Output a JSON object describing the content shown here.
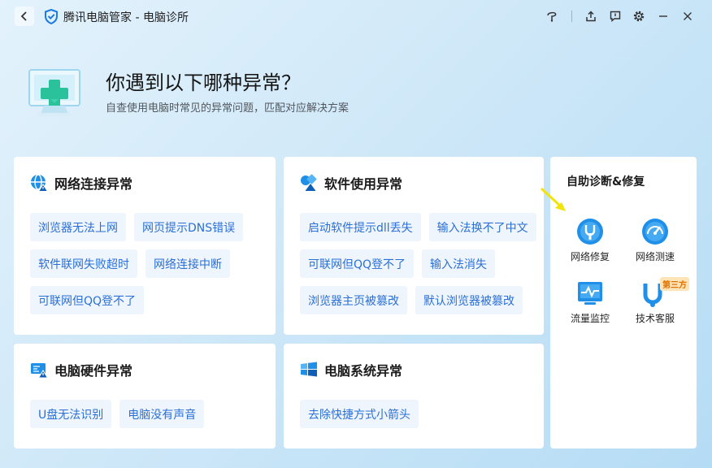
{
  "window": {
    "title": "腾讯电脑管家 - 电脑诊所"
  },
  "header": {
    "headline": "你遇到以下哪种异常？",
    "subline": "自查使用电脑时常见的异常问题，匹配对应解决方案"
  },
  "categories": [
    {
      "title": "网络连接异常",
      "icon": "globe-warning-icon",
      "rows": [
        [
          "浏览器无法上网",
          "网页提示DNS错误"
        ],
        [
          "软件联网失败超时",
          "网络连接中断"
        ],
        [
          "可联网但QQ登不了"
        ]
      ]
    },
    {
      "title": "软件使用异常",
      "icon": "shapes-icon",
      "rows": [
        [
          "启动软件提示dll丢失",
          "输入法换不了中文"
        ],
        [
          "可联网但QQ登不了",
          "输入法消失"
        ],
        [
          "浏览器主页被篡改",
          "默认浏览器被篡改"
        ]
      ]
    },
    {
      "title": "电脑硬件异常",
      "icon": "hardware-warning-icon",
      "rows": [
        [
          "U盘无法识别",
          "电脑没有声音"
        ]
      ]
    },
    {
      "title": "电脑系统异常",
      "icon": "windows-icon",
      "rows": [
        [
          "去除快捷方式小箭头"
        ]
      ]
    }
  ],
  "side_panel": {
    "title": "自助诊断&修复",
    "tools": [
      {
        "label": "网络修复",
        "icon": "network-repair-icon"
      },
      {
        "label": "网络测速",
        "icon": "speed-gauge-icon"
      },
      {
        "label": "流量监控",
        "icon": "traffic-monitor-icon"
      },
      {
        "label": "技术客服",
        "icon": "support-icon",
        "badge": "第三方"
      }
    ]
  },
  "colors": {
    "accent": "#2b6fd6",
    "chip_bg": "#eef5fd",
    "icon_blue": "#1f8fe8",
    "badge_text": "#e07000",
    "pointer_arrow": "#f2e30a"
  }
}
